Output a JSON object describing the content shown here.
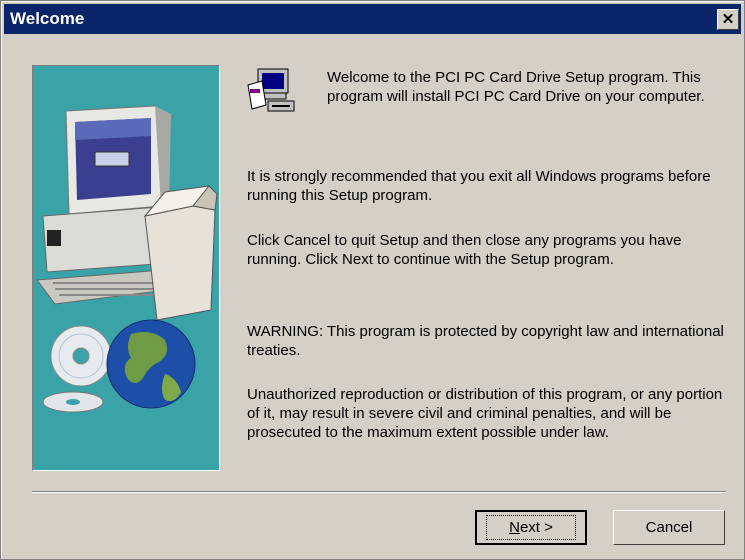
{
  "window": {
    "title": "Welcome",
    "close_symbol": "✕"
  },
  "welcome": {
    "intro": "Welcome to the PCI PC Card Drive Setup program. This program will install PCI PC Card Drive on your computer.",
    "para1": "It is strongly recommended that you exit all Windows programs before running this Setup program.",
    "para2": "Click Cancel to quit Setup and then close any programs you have running.  Click Next to continue with the Setup program.",
    "para3": "WARNING: This program is protected by copyright law and international treaties.",
    "para4": "Unauthorized reproduction or distribution of this program, or any portion of it, may result in severe civil and criminal penalties, and will be prosecuted to the maximum extent possible under law."
  },
  "buttons": {
    "next_mnemonic": "N",
    "next_rest": "ext >",
    "cancel": "Cancel"
  },
  "colors": {
    "titlebar": "#0a246a",
    "panel": "#3aa3a8",
    "face": "#d4d0c8"
  },
  "icons": [
    "computer-globe-illustration",
    "setup-icon",
    "close-icon"
  ]
}
